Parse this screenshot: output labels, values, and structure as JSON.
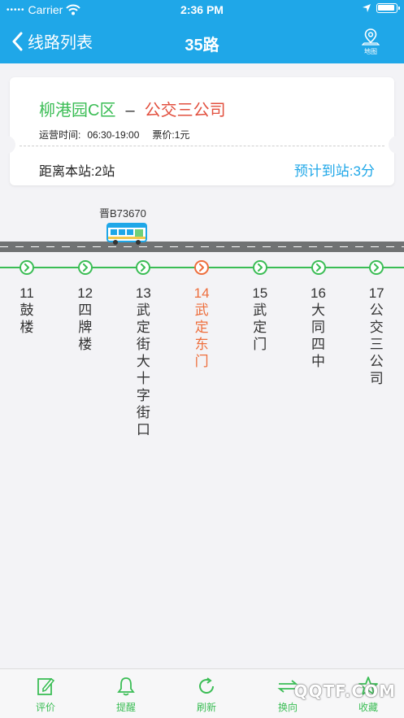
{
  "status": {
    "dots": "•••••",
    "carrier": "Carrier",
    "time": "2:36 PM"
  },
  "nav": {
    "back_label": "线路列表",
    "title": "35路",
    "map_label": "地图"
  },
  "card": {
    "from": "柳港园C区",
    "dash": "–",
    "to": "公交三公司",
    "hours_label": "运营时间:",
    "hours_value": "06:30-19:00",
    "fare": "票价:1元",
    "distance": "距离本站:2站",
    "eta": "预计到站:3分"
  },
  "bus": {
    "plate": "晋B73670",
    "position_stop_index": 2
  },
  "current_stop_index": 3,
  "stops": [
    {
      "num": "11",
      "name": "鼓楼"
    },
    {
      "num": "12",
      "name": "四牌楼"
    },
    {
      "num": "13",
      "name": "武定街大十字街口"
    },
    {
      "num": "14",
      "name": "武定东门"
    },
    {
      "num": "15",
      "name": "武定门"
    },
    {
      "num": "16",
      "name": "大同四中"
    },
    {
      "num": "17",
      "name": "公交三公司"
    }
  ],
  "tabs": [
    {
      "label": "评价",
      "icon": "edit-icon"
    },
    {
      "label": "提醒",
      "icon": "bell-icon"
    },
    {
      "label": "刷新",
      "icon": "refresh-icon"
    },
    {
      "label": "换向",
      "icon": "swap-icon"
    },
    {
      "label": "收藏",
      "icon": "star-icon"
    }
  ],
  "watermark": "QQTF.COM",
  "colors": {
    "primary": "#1fa7e8",
    "green": "#3bbd55",
    "red": "#e2503f",
    "current": "#ee6e3c"
  }
}
